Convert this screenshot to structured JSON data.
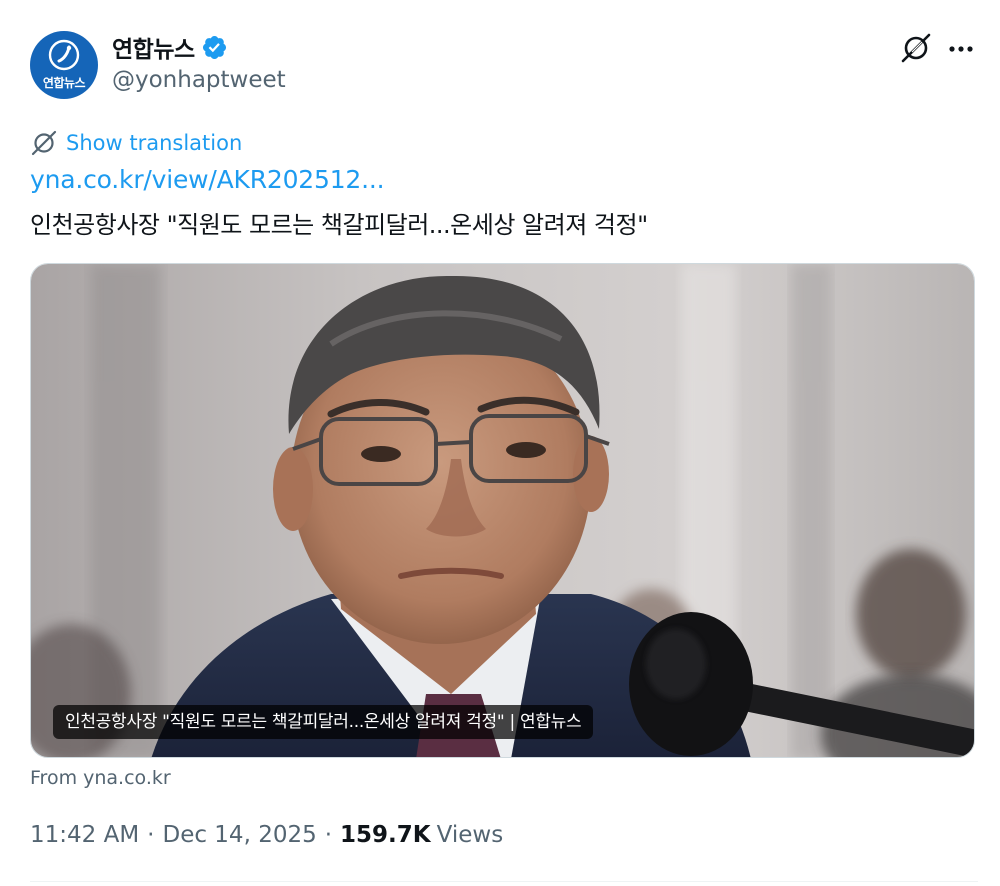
{
  "account": {
    "display_name": "연합뉴스",
    "handle": "@yonhaptweet",
    "avatar_text": "연합뉴스",
    "verified": true
  },
  "actions": {
    "grok_icon": "grok-icon",
    "more_icon": "more-icon"
  },
  "translation": {
    "label": "Show translation"
  },
  "tweet": {
    "link_text": "yna.co.kr/view/AKR202512...",
    "text": "인천공항사장 \"직원도 모르는 책갈피달러...온세상 알려져 걱정\""
  },
  "card": {
    "caption": "인천공항사장 \"직원도 모르는 책갈피달러...온세상 알려져 걱정\" | 연합뉴스",
    "from": "From yna.co.kr"
  },
  "meta": {
    "time": "11:42 AM",
    "separator": "·",
    "date": "Dec 14, 2025",
    "views_count": "159.7K",
    "views_label": "Views"
  },
  "colors": {
    "accent": "#1d9bf0",
    "secondary_text": "#536471",
    "primary_text": "#0f1419",
    "avatar_bg": "#1565b8"
  }
}
